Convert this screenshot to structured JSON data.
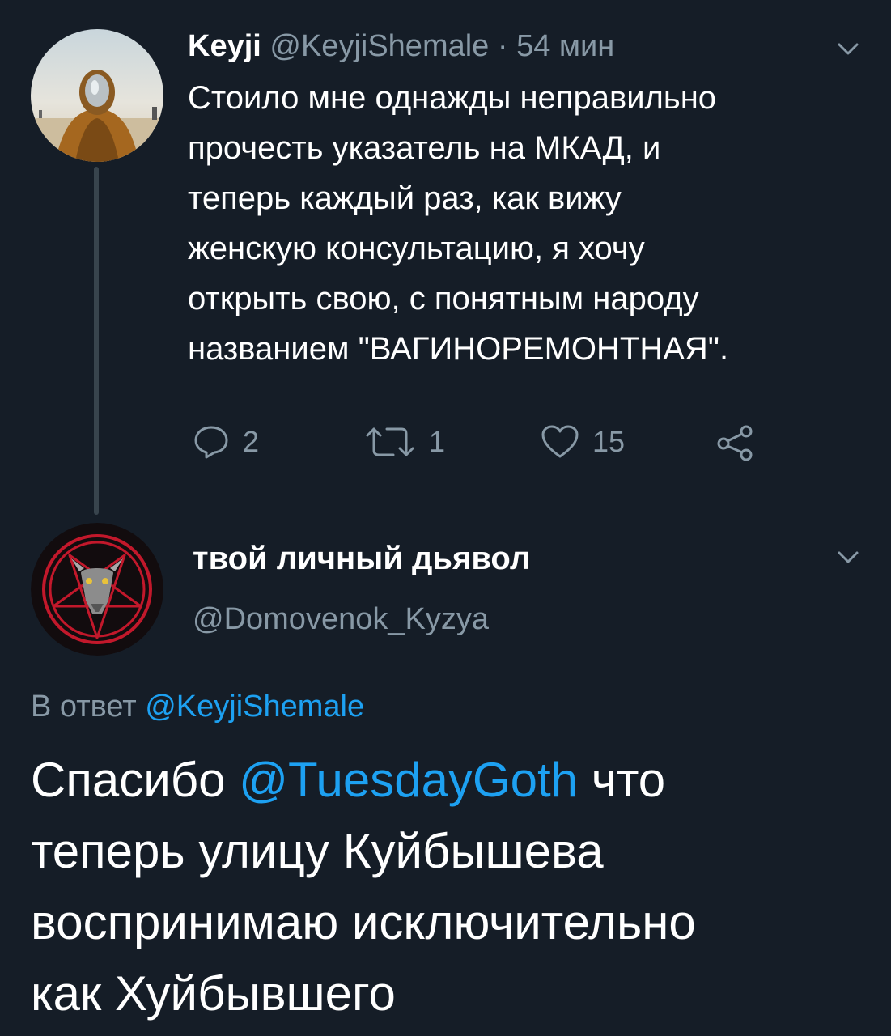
{
  "tweet": {
    "author_name": "Keyji",
    "author_handle": "@KeyjiShemale",
    "separator": "·",
    "timestamp": "54 мин",
    "body_lines": [
      "Стоило мне однажды неправильно",
      "прочесть указатель на МКАД, и",
      "теперь каждый раз, как вижу",
      "женскую консультацию, я хочу",
      "открыть свою, с понятным народу",
      "названием \"ВАГИНОРЕМОНТНАЯ\"."
    ],
    "actions": {
      "replies": "2",
      "retweets": "1",
      "likes": "15"
    }
  },
  "reply": {
    "author_name": "твой личный дьявол",
    "author_handle": "@Domovenok_Kyzya",
    "reply_to_prefix": "В ответ",
    "reply_to_handle": "@KeyjiShemale",
    "body": {
      "line1_before": "Спасибо",
      "mention": "@TuesdayGoth",
      "line1_after": "что",
      "line2": "теперь улицу Куйбышева",
      "line3": "воспринимаю исключительно",
      "line4": "как Хуйбывшего"
    }
  },
  "icons": {
    "reply": "reply-icon",
    "retweet": "retweet-icon",
    "like": "heart-icon",
    "share": "share-icon",
    "menu": "chevron-down-icon"
  },
  "colors": {
    "background": "#151d27",
    "text": "#ffffff",
    "secondary": "#8899a6",
    "link": "#1da1f2",
    "thread_line": "#38444d"
  }
}
